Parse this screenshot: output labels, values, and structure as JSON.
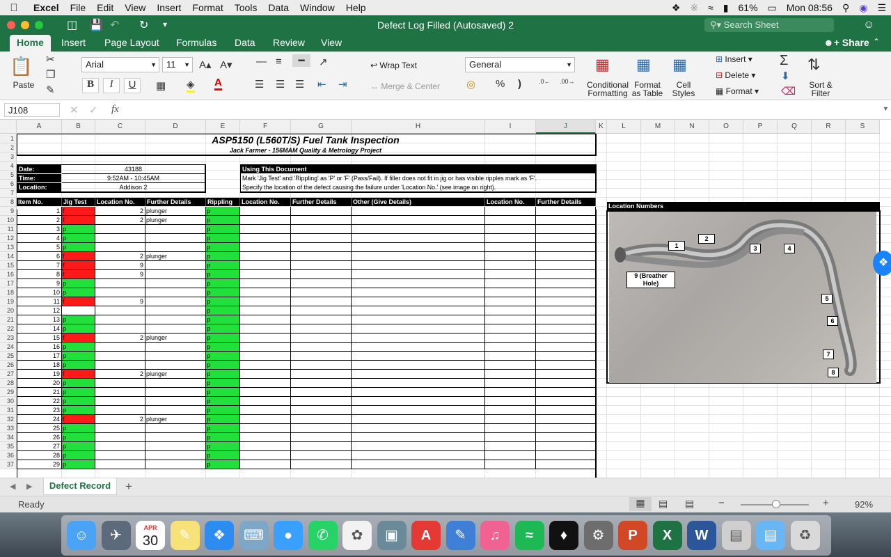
{
  "menubar": {
    "app_name": "Excel",
    "items": [
      "File",
      "Edit",
      "View",
      "Insert",
      "Format",
      "Tools",
      "Data",
      "Window",
      "Help"
    ],
    "battery": "61%",
    "clock": "Mon 08:56"
  },
  "window": {
    "title": "Defect Log Filled (Autosaved) 2",
    "search_placeholder": "Search Sheet",
    "share_label": "Share"
  },
  "ribbon_tabs": [
    "Home",
    "Insert",
    "Page Layout",
    "Formulas",
    "Data",
    "Review",
    "View"
  ],
  "ribbon": {
    "paste": "Paste",
    "font_name": "Arial",
    "font_size": "11",
    "bold": "B",
    "italic": "I",
    "underline": "U",
    "wrap_text": "Wrap Text",
    "merge_center": "Merge & Center",
    "number_format": "General",
    "percent": "%",
    "comma": ")",
    "cond_format": [
      "Conditional",
      "Formatting"
    ],
    "format_table": [
      "Format",
      "as Table"
    ],
    "cell_styles": [
      "Cell",
      "Styles"
    ],
    "insert": "Insert",
    "delete": "Delete",
    "format": "Format",
    "sort_filter": [
      "Sort &",
      "Filter"
    ],
    "sigma": "Σ"
  },
  "formula_bar": {
    "name_box": "J108",
    "fx": "fx",
    "formula": ""
  },
  "columns": [
    "A",
    "B",
    "C",
    "D",
    "E",
    "F",
    "G",
    "H",
    "I",
    "J",
    "K",
    "L",
    "M",
    "N",
    "O",
    "P",
    "Q",
    "R",
    "S"
  ],
  "rows": [
    "1",
    "2",
    "3",
    "4",
    "5",
    "6",
    "7",
    "8",
    "9",
    "10",
    "11",
    "12",
    "13",
    "14",
    "15",
    "16",
    "17",
    "18",
    "19",
    "20",
    "21",
    "22",
    "23",
    "24",
    "25",
    "26",
    "27",
    "28",
    "29",
    "30",
    "31",
    "32",
    "33",
    "34",
    "35",
    "36",
    "37"
  ],
  "sheet": {
    "title": "ASP5150 (L560T/S) Fuel Tank Inspection",
    "subtitle": "Jack Farmer - 156MAM Quality & Metrology Project",
    "info_labels": [
      "Date:",
      "Time:",
      "Location:"
    ],
    "info_values": [
      "43188",
      "9:52AM - 10:45AM",
      "Addison 2"
    ],
    "using_header": "Using This Document",
    "using_lines": [
      "Mark 'Jig Test' and 'Rippling' as 'P' or 'F' (Pass/Fail). If filler does not fit in jig or has visible ripples mark as 'F'.",
      "Specify the location of the defect causing the failure under 'Location No.' (see image on right)."
    ],
    "table_headers": [
      "Item No.",
      "Jig Test",
      "Location No.",
      "Further Details",
      "Rippling",
      "Location No.",
      "Further Details",
      "Other (Give Details)",
      "Location No.",
      "Further Details"
    ],
    "location_numbers_header": "Location Numbers",
    "records": [
      {
        "item": "1",
        "jig": "f",
        "loc": "2",
        "det": "plunger",
        "rip": "p"
      },
      {
        "item": "2",
        "jig": "f",
        "loc": "2",
        "det": "plunger",
        "rip": "p"
      },
      {
        "item": "3",
        "jig": "p",
        "loc": "",
        "det": "",
        "rip": "p"
      },
      {
        "item": "4",
        "jig": "p",
        "loc": "",
        "det": "",
        "rip": "p"
      },
      {
        "item": "5",
        "jig": "p",
        "loc": "",
        "det": "",
        "rip": "p"
      },
      {
        "item": "6",
        "jig": "f",
        "loc": "2",
        "det": "plunger",
        "rip": "p"
      },
      {
        "item": "7",
        "jig": "f",
        "loc": "9",
        "det": "",
        "rip": "p"
      },
      {
        "item": "8",
        "jig": "f",
        "loc": "9",
        "det": "",
        "rip": "p"
      },
      {
        "item": "9",
        "jig": "p",
        "loc": "",
        "det": "",
        "rip": "p"
      },
      {
        "item": "10",
        "jig": "p",
        "loc": "",
        "det": "",
        "rip": "p"
      },
      {
        "item": "11",
        "jig": "f",
        "loc": "9",
        "det": "",
        "rip": "p"
      },
      {
        "item": "12",
        "jig": "",
        "loc": "",
        "det": "",
        "rip": "p"
      },
      {
        "item": "13",
        "jig": "p",
        "loc": "",
        "det": "",
        "rip": "p"
      },
      {
        "item": "14",
        "jig": "p",
        "loc": "",
        "det": "",
        "rip": "p"
      },
      {
        "item": "15",
        "jig": "f",
        "loc": "2",
        "det": "plunger",
        "rip": "p"
      },
      {
        "item": "16",
        "jig": "p",
        "loc": "",
        "det": "",
        "rip": "p"
      },
      {
        "item": "17",
        "jig": "p",
        "loc": "",
        "det": "",
        "rip": "p"
      },
      {
        "item": "18",
        "jig": "p",
        "loc": "",
        "det": "",
        "rip": "p"
      },
      {
        "item": "19",
        "jig": "f",
        "loc": "2",
        "det": "plunger",
        "rip": "p"
      },
      {
        "item": "20",
        "jig": "p",
        "loc": "",
        "det": "",
        "rip": "p"
      },
      {
        "item": "21",
        "jig": "p",
        "loc": "",
        "det": "",
        "rip": "p"
      },
      {
        "item": "22",
        "jig": "p",
        "loc": "",
        "det": "",
        "rip": "p"
      },
      {
        "item": "23",
        "jig": "p",
        "loc": "",
        "det": "",
        "rip": "p"
      },
      {
        "item": "24",
        "jig": "f",
        "loc": "2",
        "det": "plunger",
        "rip": "p"
      },
      {
        "item": "25",
        "jig": "p",
        "loc": "",
        "det": "",
        "rip": "p"
      },
      {
        "item": "26",
        "jig": "p",
        "loc": "",
        "det": "",
        "rip": "p"
      },
      {
        "item": "27",
        "jig": "p",
        "loc": "",
        "det": "",
        "rip": "p"
      },
      {
        "item": "28",
        "jig": "p",
        "loc": "",
        "det": "",
        "rip": "p"
      },
      {
        "item": "29",
        "jig": "p",
        "loc": "",
        "det": "",
        "rip": "p"
      }
    ],
    "image_labels": [
      "1",
      "2",
      "3",
      "4",
      "5",
      "6",
      "7",
      "8",
      "9 (Breather Hole)"
    ]
  },
  "colors": {
    "pass": "#22e03c",
    "fail": "#ff1a1a",
    "excel_green": "#1f7244"
  },
  "sheet_tabs": {
    "active": "Defect Record",
    "add": "+"
  },
  "status": {
    "ready": "Ready",
    "zoom": "92%"
  },
  "dock": {
    "calendar_month": "APR",
    "calendar_day": "30",
    "icons": [
      "finder-icon",
      "launchpad-icon",
      "calendar-icon",
      "stickies-icon",
      "safari-icon",
      "preview-icon",
      "messages-icon",
      "whatsapp-icon",
      "photos-icon",
      "image-capture-icon",
      "acrobat-icon",
      "notes-icon",
      "itunes-icon",
      "spotify-icon",
      "tidal-icon",
      "system-preferences-icon",
      "powerpoint-icon",
      "excel-icon",
      "word-icon",
      "documents-icon",
      "folder-icon",
      "trash-icon"
    ]
  }
}
